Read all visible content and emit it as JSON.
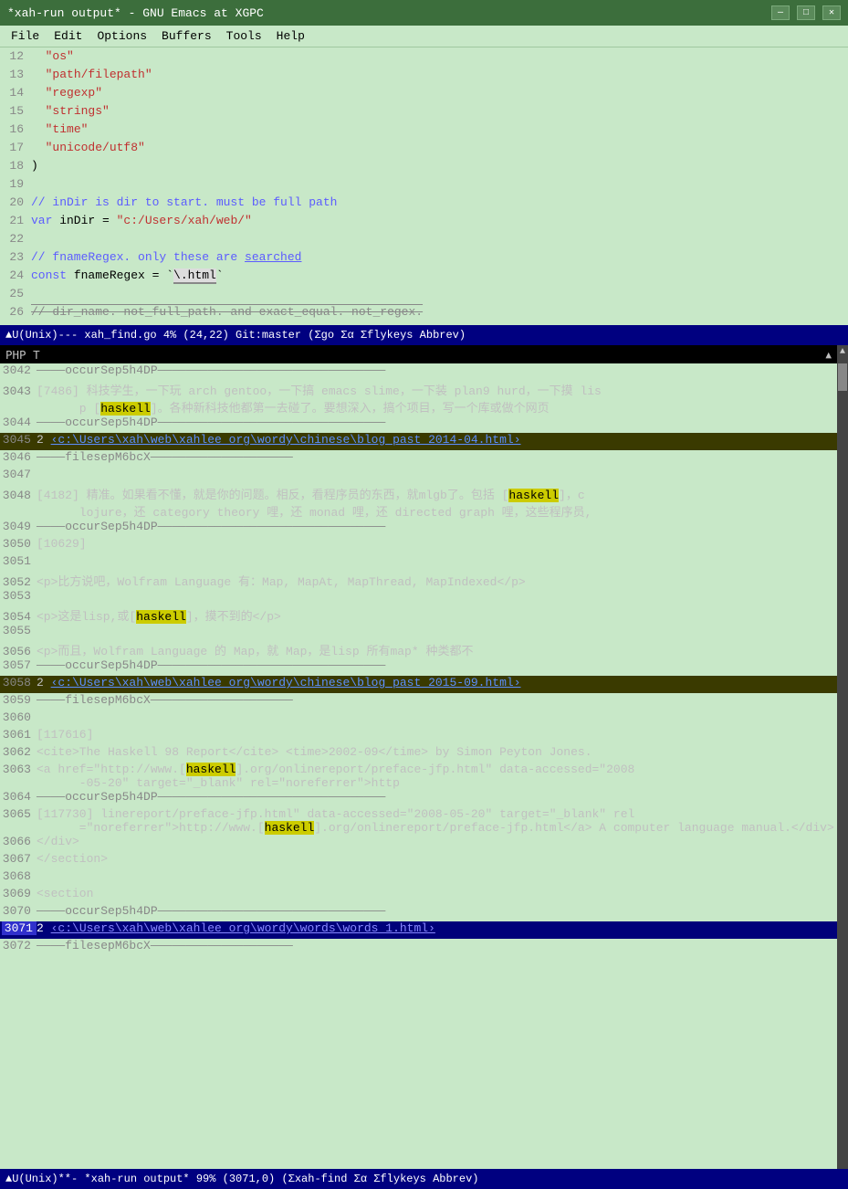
{
  "titlebar": {
    "title": "*xah-run output* - GNU Emacs at XGPC",
    "minimize": "—",
    "maximize": "□",
    "close": "✕"
  },
  "menubar": {
    "items": [
      "File",
      "Edit",
      "Options",
      "Buffers",
      "Tools",
      "Help"
    ]
  },
  "top_code": {
    "lines": [
      {
        "num": "12",
        "content": "  \"os\""
      },
      {
        "num": "13",
        "content": "  \"path/filepath\""
      },
      {
        "num": "14",
        "content": "  \"regexp\""
      },
      {
        "num": "15",
        "content": "  \"strings\""
      },
      {
        "num": "16",
        "content": "  \"time\""
      },
      {
        "num": "17",
        "content": "  \"unicode/utf8\""
      },
      {
        "num": "18",
        "content": ")"
      },
      {
        "num": "19",
        "content": ""
      },
      {
        "num": "20",
        "content": "// inDir is dir to start. must be full path"
      },
      {
        "num": "21",
        "content": "var inDir = \"c:/Users/xah/web/\""
      },
      {
        "num": "22",
        "content": ""
      },
      {
        "num": "23",
        "content": "// fnameRegex. only these are searched"
      },
      {
        "num": "24",
        "content": "const fnameRegex = `\\.html`"
      },
      {
        "num": "25",
        "content": ""
      },
      {
        "num": "26",
        "content": "// dir_name. not_full_path. and exact_equal. not_regex."
      }
    ]
  },
  "modeline_top": {
    "text": "▲U(Unix)--- xah_find.go  4% (24,22) Git:master (Σgo Σα Σflykeys Abbrev)"
  },
  "output_header": {
    "text": "PHP  T"
  },
  "output_lines": [
    {
      "num": "3042",
      "type": "separator",
      "content": "————occurSep5h4DP————————————————————————————————"
    },
    {
      "num": "3043",
      "type": "content",
      "content": "[7486] 科技学生，一下玩 arch gentoo，一下搞 emacs slime，一下装 plan9 hurd，一下摸 lisp [haskell]。各种新科技他都第一去碰了。要想深入，搞个项目，写一个库或做个网页",
      "highlight": "haskell"
    },
    {
      "num": "3044",
      "type": "separator",
      "content": "————occurSep5h4DP————————————————————————————————"
    },
    {
      "num": "3045",
      "type": "filepath",
      "content": "2 ‹c:\\Users\\xah\\web\\xahlee_org\\wordy\\chinese\\blog_past_2014-04.html›"
    },
    {
      "num": "3046",
      "type": "separator2",
      "content": "————filesepM6bcX————————————————————"
    },
    {
      "num": "3047",
      "type": "blank"
    },
    {
      "num": "3048",
      "type": "content",
      "content": "[4182] 精准。如果看不懂，就是你的问题。相反，看程序员的东西，就mlgb了。包括 [haskell]，clojure，还 category theory 哩，还 monad 哩，还 directed graph 哩，这些程序员,",
      "highlight": "haskell"
    },
    {
      "num": "3049",
      "type": "separator",
      "content": "————occurSep5h4DP————————————————————————————————"
    },
    {
      "num": "3050",
      "type": "content",
      "content": "[10629]"
    },
    {
      "num": "3051",
      "type": "blank"
    },
    {
      "num": "3052",
      "type": "content",
      "content": "<p>比方说吧，Wolfram Language 有：Map, MapAt, MapThread, MapIndexed</p>"
    },
    {
      "num": "3053",
      "type": "blank"
    },
    {
      "num": "3054",
      "type": "content",
      "content": "<p>这是lisp,或[haskell]，摸不到的</p>",
      "highlight": "haskell"
    },
    {
      "num": "3055",
      "type": "blank"
    },
    {
      "num": "3056",
      "type": "content",
      "content": "<p>而且，Wolfram Language 的 Map，就 Map，是lisp 所有map* 种类都不"
    },
    {
      "num": "3057",
      "type": "separator",
      "content": "————occurSep5h4DP————————————————————————————————"
    },
    {
      "num": "3058",
      "type": "filepath",
      "content": "2 ‹c:\\Users\\xah\\web\\xahlee_org\\wordy\\chinese\\blog_past_2015-09.html›"
    },
    {
      "num": "3059",
      "type": "separator2",
      "content": "————filesepM6bcX————————————————————"
    },
    {
      "num": "3060",
      "type": "blank"
    },
    {
      "num": "3061",
      "type": "content",
      "content": "[117616]"
    },
    {
      "num": "3062",
      "type": "content",
      "content": "<cite>The Haskell 98 Report</cite> <time>2002-09</time> by Simon Peyton Jones."
    },
    {
      "num": "3063",
      "type": "content",
      "content": "<a href=\"http://www.[haskell].org/onlinereport/preface-jfp.html\" data-accessed=\"2008-05-20\" target=\"_blank\" rel=\"noreferrer\">http",
      "highlight": "haskell"
    },
    {
      "num": "3064",
      "type": "separator",
      "content": "————occurSep5h4DP————————————————————————————————"
    },
    {
      "num": "3065",
      "type": "content",
      "content": "[117730] linereport/preface-jfp.html\" data-accessed=\"2008-05-20\" target=\"_blank\" rel =\"noreferrer\">http://www.[haskell].org/onlinereport/preface-jfp.html</a> A computer language manual.</div>",
      "highlight": "haskell"
    },
    {
      "num": "3066",
      "type": "content",
      "content": "</div>"
    },
    {
      "num": "3067",
      "type": "content",
      "content": "</section>"
    },
    {
      "num": "3068",
      "type": "blank"
    },
    {
      "num": "3069",
      "type": "content",
      "content": "<section"
    },
    {
      "num": "3070",
      "type": "separator",
      "content": "————occurSep5h4DP————————————————————————————————"
    },
    {
      "num": "3071",
      "type": "filepath",
      "content": "2 ‹c:\\Users\\xah\\web\\xahlee_org\\wordy\\words\\words_1.html›"
    },
    {
      "num": "3072",
      "type": "separator2",
      "content": "————filesepM6bcX————————————————————"
    }
  ],
  "modeline_bottom": {
    "text": "▲U(Unix)**- *xah-run output* 99% (3071,0) (Σxah-find Σα Σflykeys Abbrev)"
  }
}
